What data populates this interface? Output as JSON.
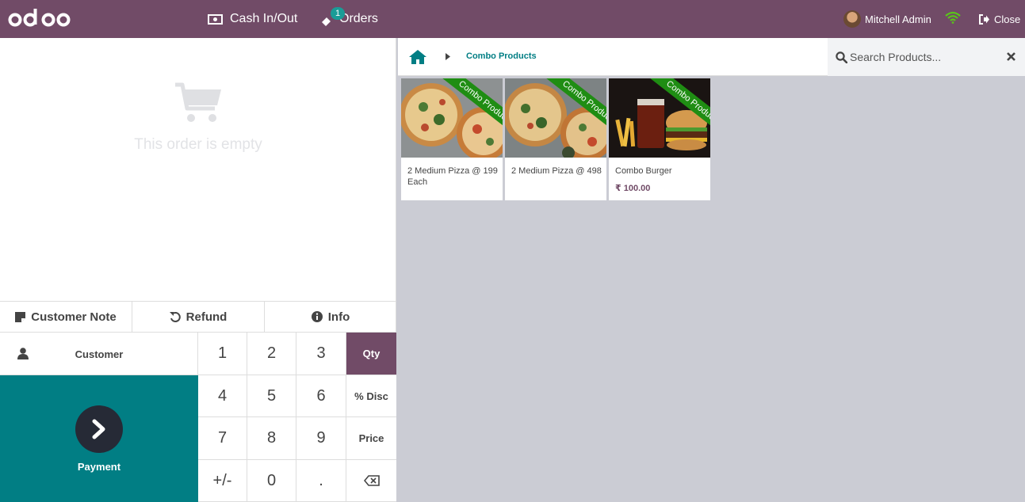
{
  "topbar": {
    "logo_text": "odoo",
    "cash_label": "Cash In/Out",
    "orders_label": "Orders",
    "orders_badge": "1",
    "user_name": "Mitchell Admin",
    "close_label": "Close",
    "colors": {
      "bar": "#714b67",
      "badge": "#1a9c97",
      "wifi": "#5ac41a"
    }
  },
  "order": {
    "empty_text": "This order is empty",
    "actions": [
      {
        "label": "Customer Note",
        "icon": "note-icon"
      },
      {
        "label": "Refund",
        "icon": "undo-icon"
      },
      {
        "label": "Info",
        "icon": "info-icon"
      }
    ],
    "customer_label": "Customer",
    "payment_label": "Payment"
  },
  "numpad": {
    "keys": [
      "1",
      "2",
      "3",
      "Qty",
      "4",
      "5",
      "6",
      "% Disc",
      "7",
      "8",
      "9",
      "Price",
      "+/-",
      "0",
      "."
    ],
    "active_mode": "Qty",
    "backspace_icon": "backspace-icon"
  },
  "products_header": {
    "breadcrumb": "Combo Products",
    "search_placeholder": "Search Products..."
  },
  "products": [
    {
      "name": "2 Medium Pizza @ 199 Each",
      "price": "",
      "ribbon": "Combo Product",
      "image": "pizza-image"
    },
    {
      "name": "2 Medium Pizza @ 498",
      "price": "",
      "ribbon": "Combo Product",
      "image": "pizza-image"
    },
    {
      "name": "Combo Burger",
      "price": "₹ 100.00",
      "ribbon": "Combo Product",
      "image": "burger-image"
    }
  ]
}
